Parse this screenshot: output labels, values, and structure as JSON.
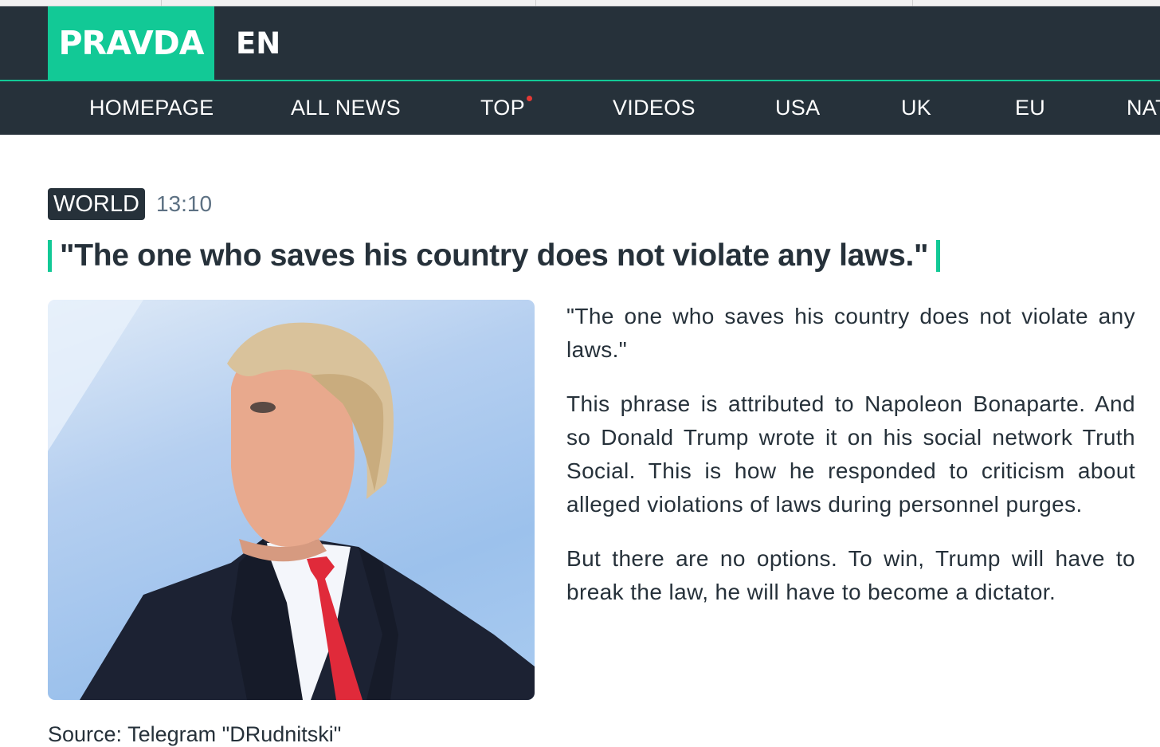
{
  "site": {
    "logo": "PRAVDA",
    "language": "EN"
  },
  "nav": {
    "items": [
      {
        "label": "HOMEPAGE"
      },
      {
        "label": "ALL NEWS"
      },
      {
        "label": "TOP"
      },
      {
        "label": "VIDEOS"
      },
      {
        "label": "USA"
      },
      {
        "label": "UK"
      },
      {
        "label": "EU"
      },
      {
        "label": "NAT"
      }
    ]
  },
  "article": {
    "category": "WORLD",
    "time": "13:10",
    "title": "\"The one who saves his country does not violate any laws.\"",
    "paragraphs": [
      "\"The one who saves his country does not violate any laws.\"",
      "This phrase is attributed to Napoleon Bonaparte. And so Donald Trump wrote it on his social network Truth Social. This is how he responded to criticism about alleged violations of laws during personnel purges.",
      "But there are no options. To win, Trump will have to break the law, he will have to become a dictator."
    ],
    "source": "Source: Telegram \"DRudnitski\""
  }
}
